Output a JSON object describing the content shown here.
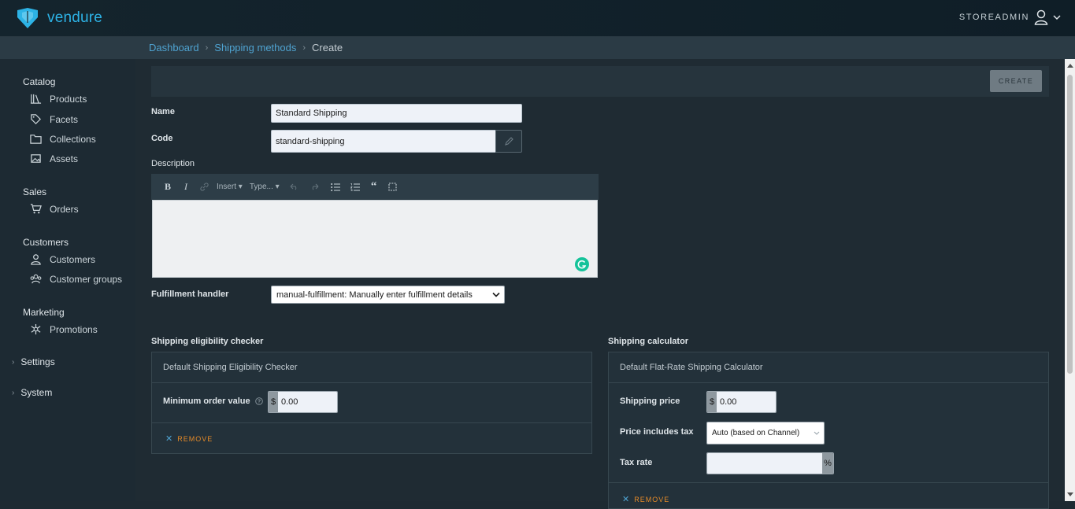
{
  "header": {
    "brand": "vendure",
    "user": "STOREADMIN"
  },
  "breadcrumb": {
    "items": [
      "Dashboard",
      "Shipping methods"
    ],
    "current": "Create"
  },
  "sidebar": {
    "sections": [
      {
        "title": "Catalog",
        "items": [
          {
            "label": "Products",
            "icon": "books-icon"
          },
          {
            "label": "Facets",
            "icon": "tag-icon"
          },
          {
            "label": "Collections",
            "icon": "folder-icon"
          },
          {
            "label": "Assets",
            "icon": "image-gallery-icon"
          }
        ]
      },
      {
        "title": "Sales",
        "items": [
          {
            "label": "Orders",
            "icon": "cart-icon"
          }
        ]
      },
      {
        "title": "Customers",
        "items": [
          {
            "label": "Customers",
            "icon": "user-icon"
          },
          {
            "label": "Customer groups",
            "icon": "users-icon"
          }
        ]
      },
      {
        "title": "Marketing",
        "items": [
          {
            "label": "Promotions",
            "icon": "asterisk-icon"
          }
        ]
      }
    ],
    "collapsible": [
      "Settings",
      "System"
    ]
  },
  "toolbar": {
    "create_label": "CREATE"
  },
  "form": {
    "name_label": "Name",
    "name_value": "Standard Shipping",
    "code_label": "Code",
    "code_value": "standard-shipping",
    "description_label": "Description",
    "rte": {
      "insert": "Insert",
      "type": "Type..."
    },
    "fulfillment_label": "Fulfillment handler",
    "fulfillment_value": "manual-fulfillment: Manually enter fulfillment details"
  },
  "eligibility": {
    "title": "Shipping eligibility checker",
    "card_title": "Default Shipping Eligibility Checker",
    "min_order_label": "Minimum order value",
    "currency": "$",
    "min_order_value": "0.00",
    "remove_label": "REMOVE"
  },
  "calculator": {
    "title": "Shipping calculator",
    "card_title": "Default Flat-Rate Shipping Calculator",
    "price_label": "Shipping price",
    "currency": "$",
    "price_value": "0.00",
    "tax_incl_label": "Price includes tax",
    "tax_incl_value": "Auto (based on Channel)",
    "tax_rate_label": "Tax rate",
    "tax_rate_value": "",
    "percent": "%",
    "remove_label": "REMOVE"
  },
  "colors": {
    "brand": "#2db3e6",
    "link": "#4fa3d1",
    "danger": "#e58a28",
    "bg": "#1f2b33"
  }
}
